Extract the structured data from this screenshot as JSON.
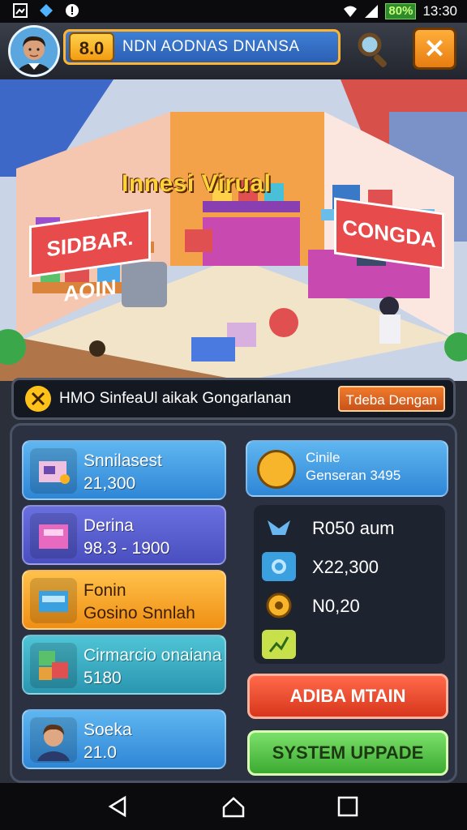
{
  "status_bar": {
    "battery": "80%",
    "time": "13:30"
  },
  "header": {
    "level": "8.0",
    "player_name": "NDN AODNAS DNANSA",
    "close_glyph": "✕"
  },
  "scene": {
    "title": "Innesi Virual",
    "sign_left": "SIDBAR. AOIN",
    "sign_right": "CONGDA"
  },
  "mission": {
    "text": "HMO SinfeaUl aikak Gongarlanan",
    "button": "Tdeba Dengan"
  },
  "cards": [
    {
      "title": "Snnilasest",
      "value": "21,300"
    },
    {
      "title": "Derina",
      "value": "98.3 - 1900"
    },
    {
      "title": "Fonin",
      "value": "Gosino Snnlah"
    },
    {
      "title": "Cirmarcio onaiana",
      "value": "5180"
    },
    {
      "title": "Soeka",
      "value": "21.0"
    }
  ],
  "stats": {
    "head_title": "Cinile",
    "head_sub": "Genseran 3495",
    "rows": [
      {
        "icon": "wings-icon",
        "value": "R050 aum"
      },
      {
        "icon": "coin-icon",
        "value": "X22,300"
      },
      {
        "icon": "gear-icon",
        "value": "N0,20"
      },
      {
        "icon": "chart-icon",
        "value": ""
      }
    ]
  },
  "buttons": {
    "red": "ADIBA MTAIN",
    "green": "SYSTEM UPPADE"
  },
  "colors": {
    "accent_orange": "#f39c12",
    "card_blue": "#2f86d6",
    "card_purple": "#4a4fc0",
    "card_orange": "#f08f14",
    "card_teal": "#2a96b0",
    "btn_red": "#d8361c",
    "btn_green": "#3caa32"
  }
}
